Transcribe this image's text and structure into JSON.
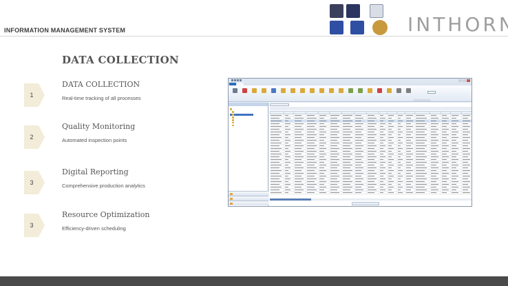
{
  "header": {
    "system_title": "INFORMATION MANAGEMENT SYSTEM",
    "brand": "INTHORN",
    "logos": [
      {
        "icon": "certification-logo-1",
        "color": "#3a3f5c"
      },
      {
        "icon": "certification-logo-2",
        "color": "#2b3560"
      },
      {
        "icon": "certification-logo-3",
        "color": "#d8dde6"
      },
      {
        "icon": "certification-logo-4",
        "color": "#2f4fa2"
      },
      {
        "icon": "certification-logo-5",
        "color": "#2f4fa2"
      },
      {
        "icon": "certification-logo-6",
        "color": "#c89a3c"
      }
    ]
  },
  "main": {
    "heading": "DATA COLLECTION",
    "steps": [
      {
        "number": "1",
        "title": "DATA COLLECTION",
        "description": "Real-time tracking of all processes"
      },
      {
        "number": "2",
        "title": "Quality Monitoring",
        "description": "Automated inspection points"
      },
      {
        "number": "3",
        "title": "Digital Reporting",
        "description": "Comprehensive production analytics"
      },
      {
        "number": "3",
        "title": "Resource Optimization",
        "description": "Efficiency-driven scheduling"
      }
    ]
  },
  "colors": {
    "step_marker": "#f2ecd8",
    "bottom_bar": "#4a4a4a",
    "brand": "#9e9e9e"
  }
}
